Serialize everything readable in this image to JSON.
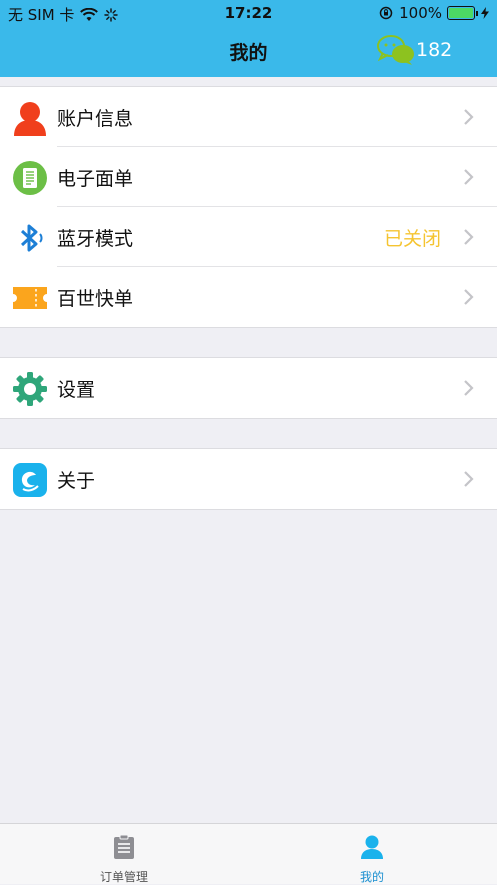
{
  "status_bar": {
    "carrier": "无 SIM 卡",
    "time": "17:22",
    "battery_percent": "100%"
  },
  "header": {
    "title": "我的",
    "chat_count": "182"
  },
  "menu_groups": [
    [
      {
        "label": "账户信息",
        "icon": "user-icon"
      },
      {
        "label": "电子面单",
        "icon": "document-icon"
      },
      {
        "label": "蓝牙模式",
        "icon": "bluetooth-icon",
        "value": "已关闭"
      },
      {
        "label": "百世快单",
        "icon": "ticket-icon"
      }
    ],
    [
      {
        "label": "设置",
        "icon": "gear-icon"
      }
    ],
    [
      {
        "label": "关于",
        "icon": "app-logo-icon"
      }
    ]
  ],
  "tabbar": {
    "tabs": [
      {
        "label": "订单管理",
        "icon": "clipboard-icon"
      },
      {
        "label": "我的",
        "icon": "profile-icon"
      }
    ]
  },
  "colors": {
    "header_bg": "#3ab9ea",
    "bluetooth_status": "#f5c431",
    "tab_active": "#2ba6e0",
    "tab_inactive": "#8e8e93"
  }
}
